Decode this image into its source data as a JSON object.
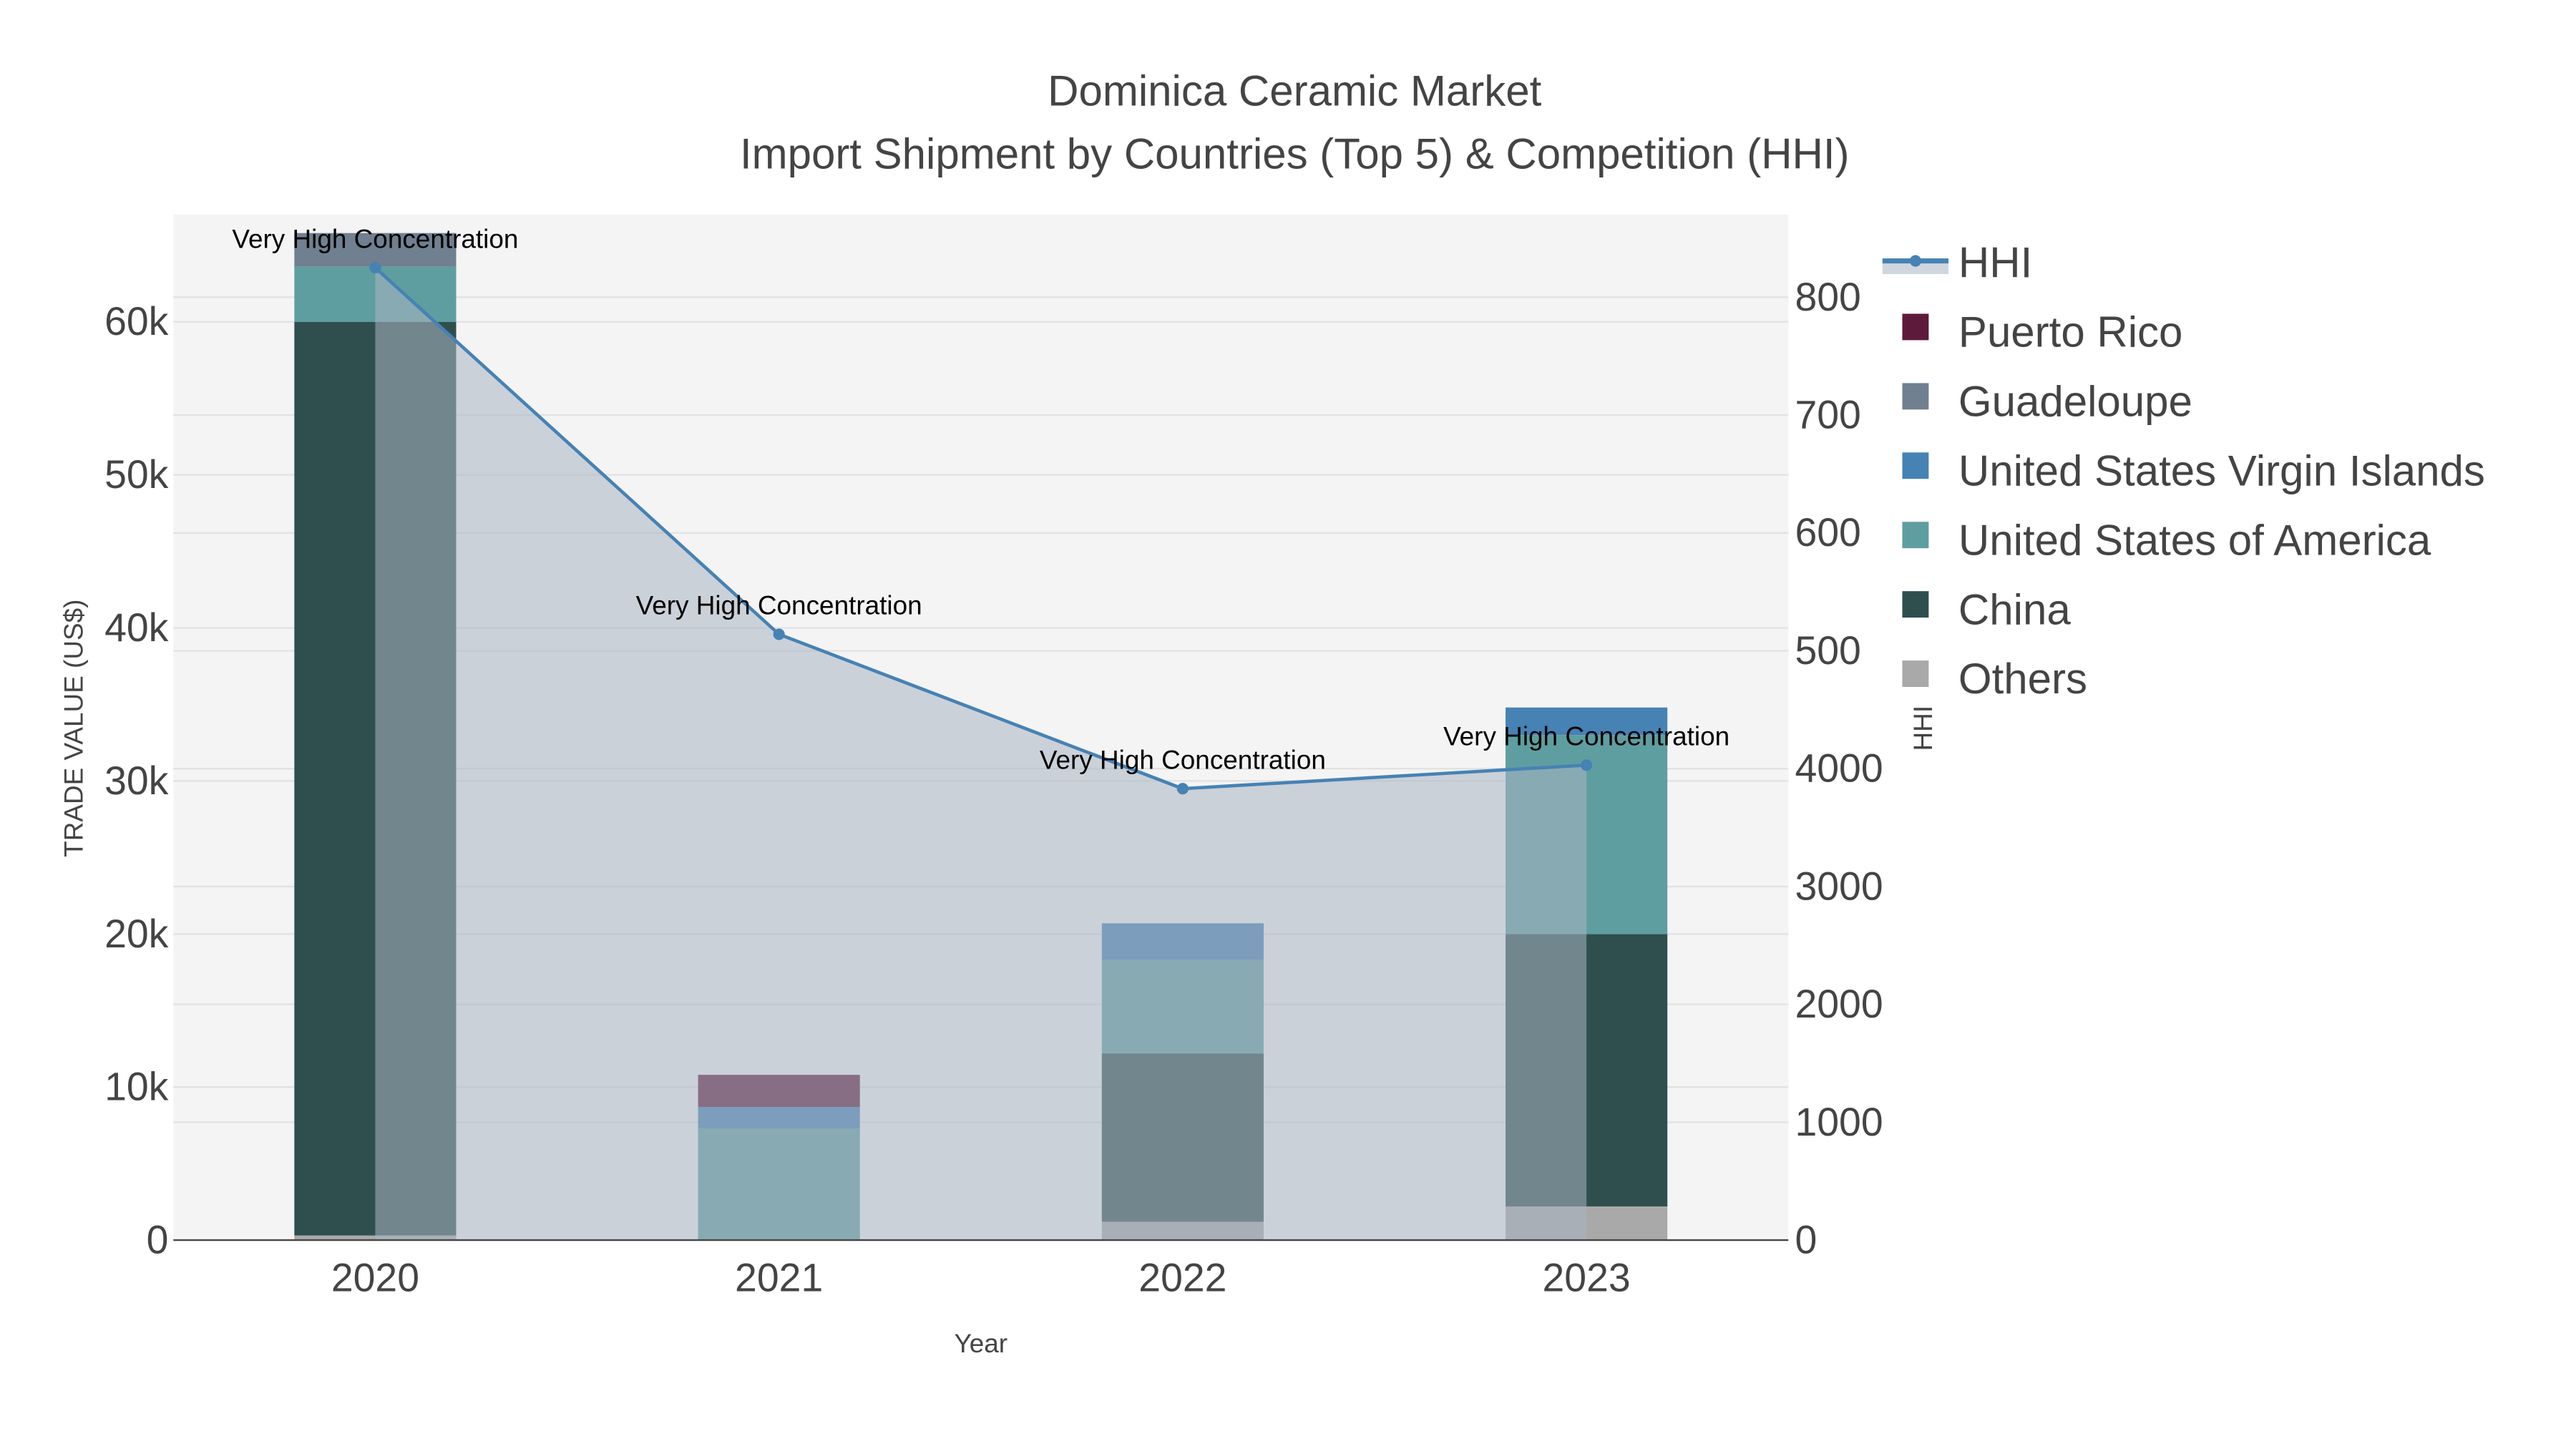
{
  "chart_data": {
    "type": "bar",
    "title": "Dominica Ceramic Market",
    "subtitle": "Import Shipment by Countries (Top 5) & Competition (HHI)",
    "xlabel": "Year",
    "ylabel": "TRADE VALUE (US$)",
    "y2label": "HHI",
    "categories": [
      "2020",
      "2021",
      "2022",
      "2023"
    ],
    "ylim": [
      0,
      67000
    ],
    "y2lim": [
      0,
      8700
    ],
    "yticks": [
      {
        "v": 0,
        "label": "0"
      },
      {
        "v": 10000,
        "label": "10k"
      },
      {
        "v": 20000,
        "label": "20k"
      },
      {
        "v": 30000,
        "label": "30k"
      },
      {
        "v": 40000,
        "label": "40k"
      },
      {
        "v": 50000,
        "label": "50k"
      },
      {
        "v": 60000,
        "label": "60k"
      }
    ],
    "y2ticks": [
      {
        "v": 0,
        "label": "0"
      },
      {
        "v": 1000,
        "label": "1000"
      },
      {
        "v": 2000,
        "label": "2000"
      },
      {
        "v": 3000,
        "label": "3000"
      },
      {
        "v": 4000,
        "label": "4000"
      },
      {
        "v": 5000,
        "label": "500"
      },
      {
        "v": 6000,
        "label": "600"
      },
      {
        "v": 7000,
        "label": "700"
      },
      {
        "v": 8000,
        "label": "800"
      }
    ],
    "series": [
      {
        "name": "Others",
        "color": "#a9a9a9",
        "values": [
          300,
          0,
          1200,
          2200
        ]
      },
      {
        "name": "China",
        "color": "#2f4f4f",
        "values": [
          59700,
          0,
          11000,
          17800
        ]
      },
      {
        "name": "United States of America",
        "color": "#5f9ea0",
        "values": [
          3600,
          7300,
          6100,
          13000
        ]
      },
      {
        "name": "United States Virgin Islands",
        "color": "#4682b4",
        "values": [
          0,
          1400,
          2400,
          1800
        ]
      },
      {
        "name": "Guadeloupe",
        "color": "#708090",
        "values": [
          2200,
          0,
          0,
          0
        ]
      },
      {
        "name": "Puerto Rico",
        "color": "#5e1a3a",
        "values": [
          0,
          2100,
          0,
          0
        ]
      }
    ],
    "hhi": {
      "name": "HHI",
      "color": "#4682b4",
      "values": [
        8250,
        5140,
        3830,
        4030
      ],
      "annotations": [
        "Very High Concentration",
        "Very High Concentration",
        "Very High Concentration",
        "Very High Concentration"
      ]
    },
    "legend_order": [
      "HHI",
      "Puerto Rico",
      "Guadeloupe",
      "United States Virgin Islands",
      "United States of America",
      "China",
      "Others"
    ],
    "legend_position": "right",
    "grid": true
  }
}
